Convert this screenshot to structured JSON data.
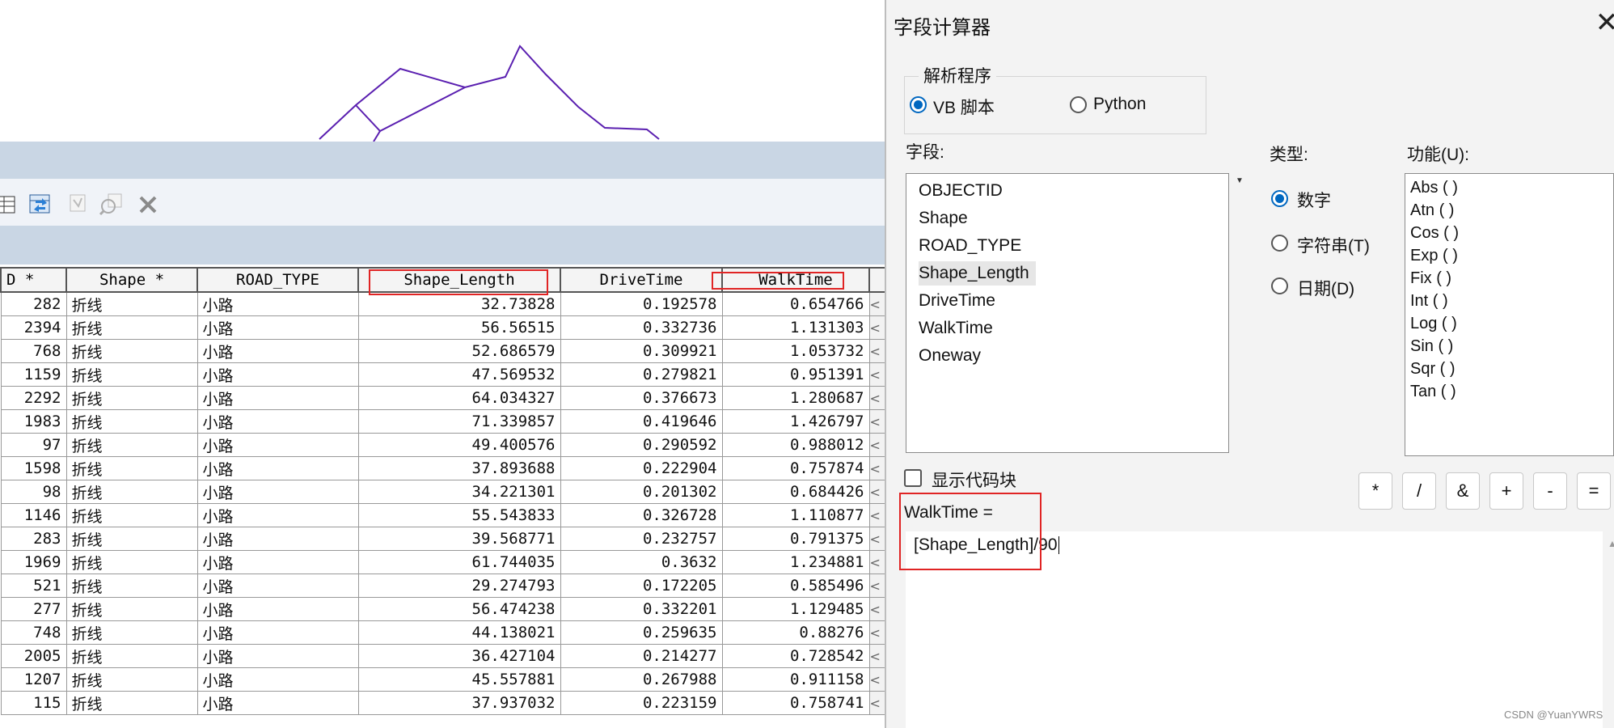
{
  "attribute_table": {
    "columns": [
      "D *",
      "Shape *",
      "ROAD_TYPE",
      "Shape_Length",
      "DriveTime",
      "WalkTime"
    ],
    "rows": [
      [
        "282",
        "折线",
        "小路",
        "32.73828",
        "0.192578",
        "0.654766"
      ],
      [
        "2394",
        "折线",
        "小路",
        "56.56515",
        "0.332736",
        "1.131303"
      ],
      [
        "768",
        "折线",
        "小路",
        "52.686579",
        "0.309921",
        "1.053732"
      ],
      [
        "1159",
        "折线",
        "小路",
        "47.569532",
        "0.279821",
        "0.951391"
      ],
      [
        "2292",
        "折线",
        "小路",
        "64.034327",
        "0.376673",
        "1.280687"
      ],
      [
        "1983",
        "折线",
        "小路",
        "71.339857",
        "0.419646",
        "1.426797"
      ],
      [
        "97",
        "折线",
        "小路",
        "49.400576",
        "0.290592",
        "0.988012"
      ],
      [
        "1598",
        "折线",
        "小路",
        "37.893688",
        "0.222904",
        "0.757874"
      ],
      [
        "98",
        "折线",
        "小路",
        "34.221301",
        "0.201302",
        "0.684426"
      ],
      [
        "1146",
        "折线",
        "小路",
        "55.543833",
        "0.326728",
        "1.110877"
      ],
      [
        "283",
        "折线",
        "小路",
        "39.568771",
        "0.232757",
        "0.791375"
      ],
      [
        "1969",
        "折线",
        "小路",
        "61.744035",
        "0.3632",
        "1.234881"
      ],
      [
        "521",
        "折线",
        "小路",
        "29.274793",
        "0.172205",
        "0.585496"
      ],
      [
        "277",
        "折线",
        "小路",
        "56.474238",
        "0.332201",
        "1.129485"
      ],
      [
        "748",
        "折线",
        "小路",
        "44.138021",
        "0.259635",
        "0.88276"
      ],
      [
        "2005",
        "折线",
        "小路",
        "36.427104",
        "0.214277",
        "0.728542"
      ],
      [
        "1207",
        "折线",
        "小路",
        "45.557881",
        "0.267988",
        "0.911158"
      ],
      [
        "115",
        "折线",
        "小路",
        "37.937032",
        "0.223159",
        "0.758741"
      ]
    ],
    "row_scroll_glyph": "<"
  },
  "dialog": {
    "title": "字段计算器",
    "close_glyph": "✕",
    "parser": {
      "legend": "解析程序",
      "options": [
        "VB 脚本",
        "Python"
      ],
      "selected": "VB 脚本"
    },
    "fields_label": "字段:",
    "fields": [
      "OBJECTID",
      "Shape",
      "ROAD_TYPE",
      "Shape_Length",
      "DriveTime",
      "WalkTime",
      "Oneway"
    ],
    "selected_field": "Shape_Length",
    "type_label": "类型:",
    "types": [
      "数字",
      "字符串(T)",
      "日期(D)"
    ],
    "selected_type": "数字",
    "functions_label": "功能(U):",
    "functions": [
      "Abs ( )",
      "Atn ( )",
      "Cos ( )",
      "Exp ( )",
      "Fix ( )",
      "Int ( )",
      "Log ( )",
      "Sin ( )",
      "Sqr ( )",
      "Tan ( )"
    ],
    "show_codeblock_label": "显示代码块",
    "show_codeblock_checked": false,
    "operators": [
      "*",
      "/",
      "&",
      "+",
      "-",
      "="
    ],
    "expression_target": "WalkTime =",
    "expression": "[Shape_Length]/90"
  },
  "watermark": "CSDN @YuanYWRS",
  "colors": {
    "highlight": "#e02424",
    "accent": "#0067c0",
    "road_line": "#5a1fb0"
  }
}
